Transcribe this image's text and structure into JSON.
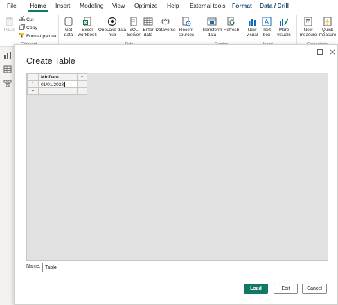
{
  "tabs": [
    {
      "label": "File"
    },
    {
      "label": "Home"
    },
    {
      "label": "Insert"
    },
    {
      "label": "Modeling"
    },
    {
      "label": "View"
    },
    {
      "label": "Optimize"
    },
    {
      "label": "Help"
    },
    {
      "label": "External tools"
    },
    {
      "label": "Format"
    },
    {
      "label": "Data / Drill"
    }
  ],
  "active_tab": "Home",
  "ribbon": {
    "clipboard": {
      "paste": "Paste",
      "cut": "Cut",
      "copy": "Copy",
      "format_painter": "Format painter",
      "group_label": "Clipboard"
    },
    "data": {
      "get_data": [
        "Get",
        "data"
      ],
      "excel": [
        "Excel",
        "workbook"
      ],
      "onelake": [
        "OneLake data",
        "hub"
      ],
      "sql": [
        "SQL",
        "Server"
      ],
      "enter": [
        "Enter",
        "data"
      ],
      "dataverse": [
        "Dataverse"
      ],
      "recent": [
        "Recent",
        "sources"
      ],
      "group_label": "Data"
    },
    "queries": {
      "transform": [
        "Transform",
        "data"
      ],
      "refresh": [
        "Refresh"
      ],
      "group_label": "Queries"
    },
    "insert": {
      "new_visual": [
        "New",
        "visual"
      ],
      "text_box": [
        "Text",
        "box"
      ],
      "more_visuals": [
        "More",
        "visuals"
      ],
      "group_label": "Insert"
    },
    "calculations": {
      "new_measure": [
        "New",
        "measure"
      ],
      "quick_measure": [
        "Quick",
        "measure"
      ],
      "group_label": "Calculations"
    }
  },
  "dialog": {
    "title": "Create Table",
    "table": {
      "add_column": "+",
      "add_row": "+",
      "columns": [
        "MinDate"
      ],
      "rows": [
        {
          "row_num": "1",
          "cells": [
            "01/01/2023"
          ]
        }
      ]
    },
    "name_label": "Name:",
    "name_value": "Table",
    "buttons": {
      "load": "Load",
      "edit": "Edit",
      "cancel": "Cancel"
    }
  },
  "colors": {
    "accent": "#117865",
    "ribbon_bg": "#ffffff",
    "canvas_bg": "#f3f2f1",
    "grid_bg": "#e1e1e1"
  }
}
